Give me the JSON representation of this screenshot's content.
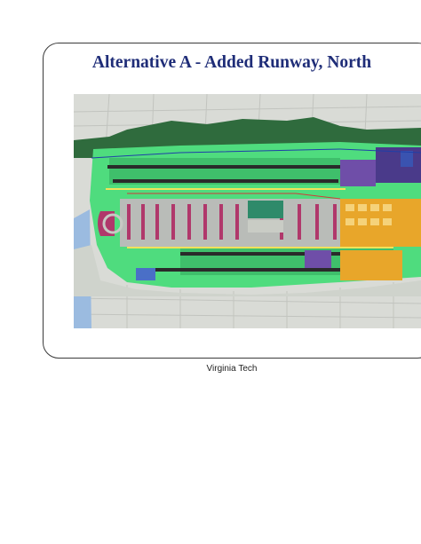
{
  "slide": {
    "title": "Alternative A - Added Runway, North",
    "footer": "Virginia Tech"
  },
  "colors": {
    "title": "#1f2d78",
    "airfield_green": "#4fdc7e",
    "dark_green": "#2f6b3d",
    "runway": "#2a2a2a",
    "apron_gray": "#b9bcb8",
    "terminal_magenta": "#b0386b",
    "cargo_yellow": "#e8a62a",
    "purple_zone": "#6f4ea8",
    "ocean_blue": "#8fb3d9"
  },
  "map": {
    "image_name": "airport-site-plan",
    "description_icon": "airport-layout-icon"
  }
}
